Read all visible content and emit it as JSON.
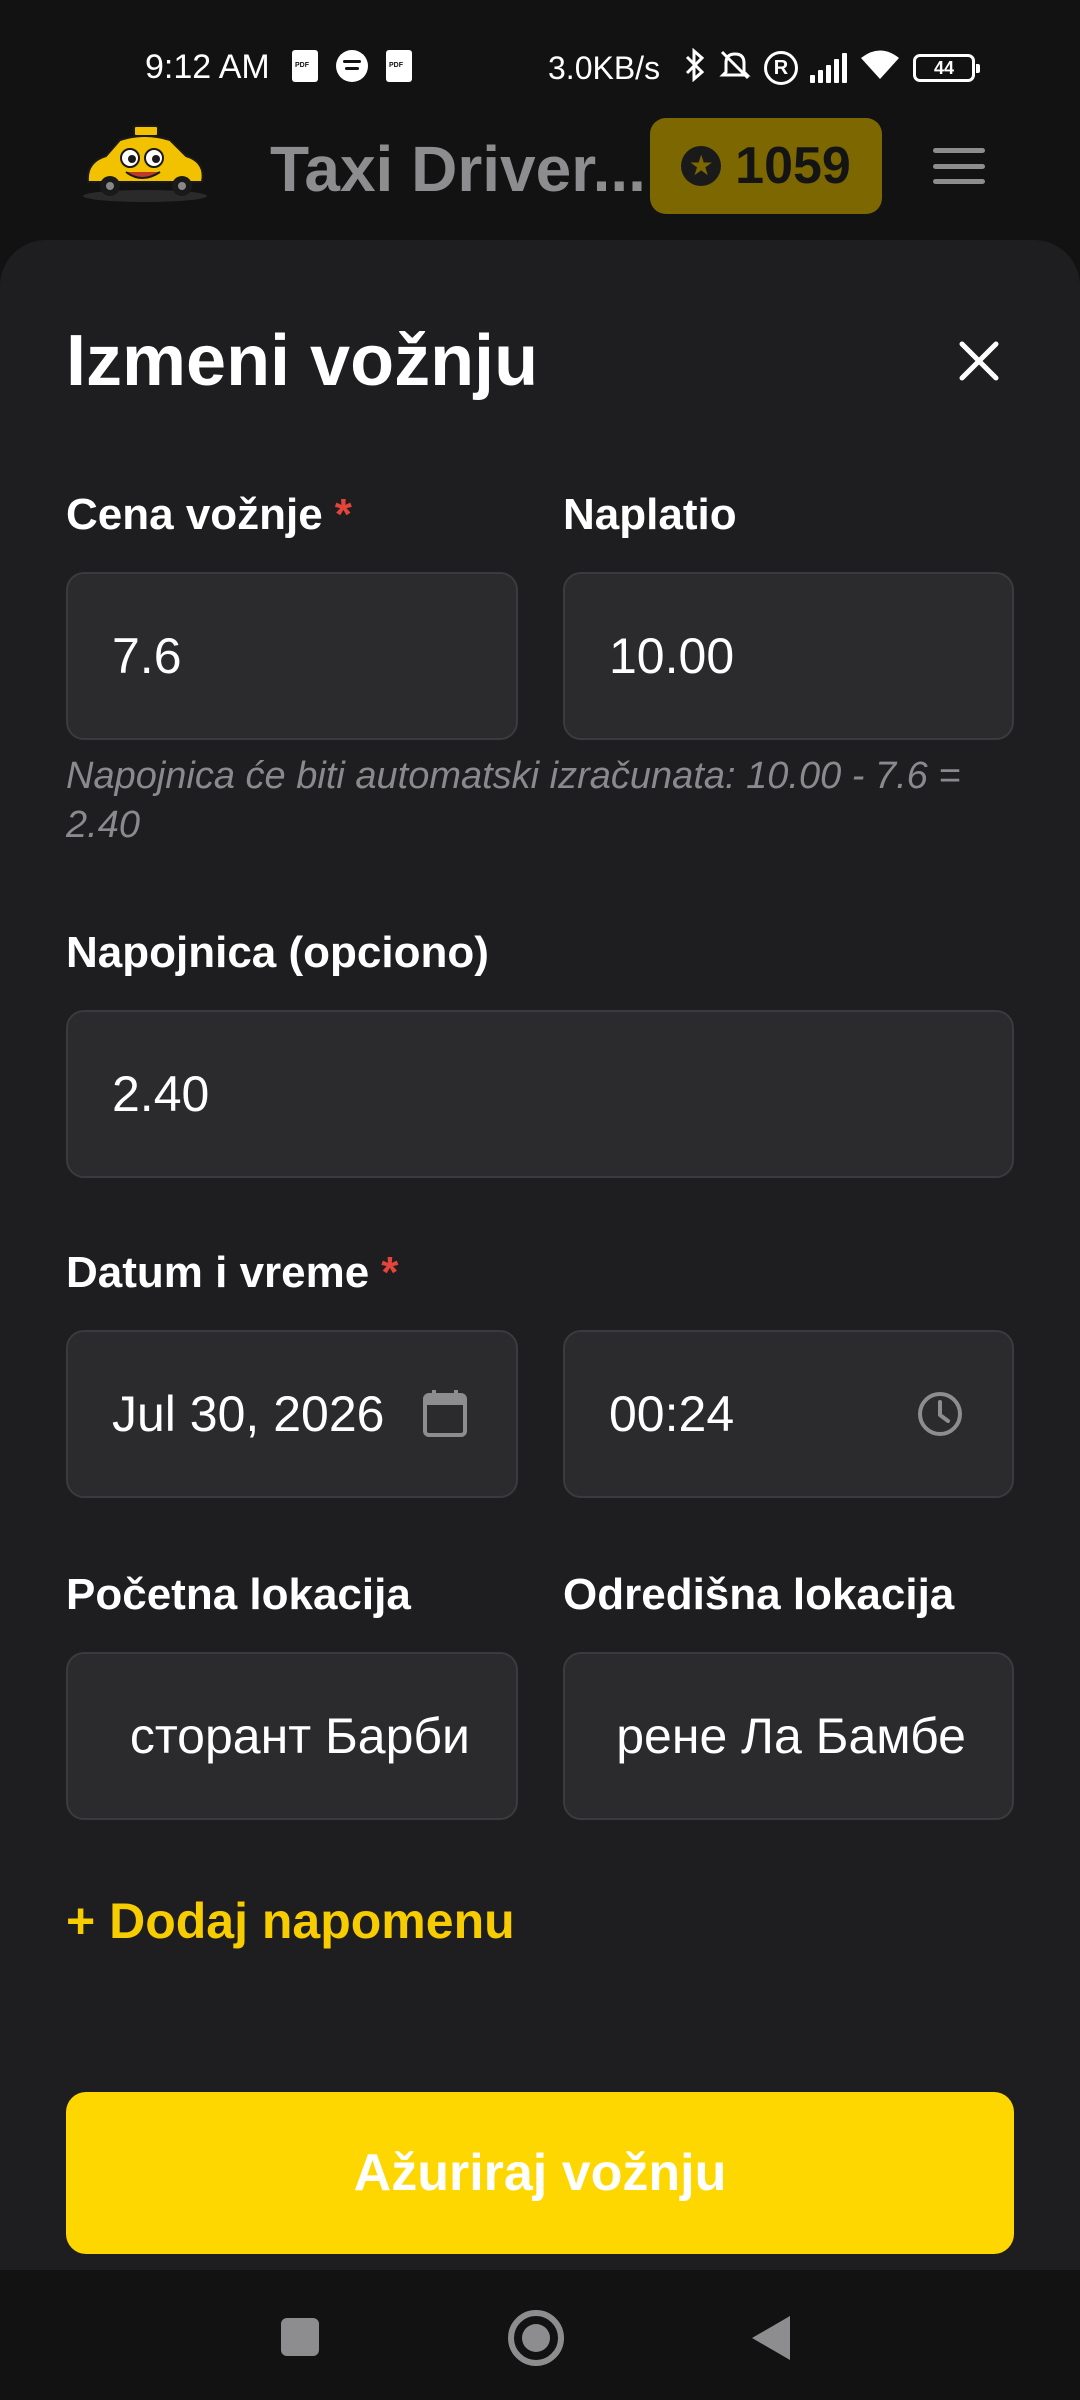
{
  "status_bar": {
    "time": "9:12 AM",
    "speed": "3.0KB/s",
    "battery": "44"
  },
  "header": {
    "title": "Taxi Driver...",
    "points": "1059",
    "accent": "#7c6700"
  },
  "sheet": {
    "title": "Izmeni vožnju",
    "price": {
      "label": "Cena vožnje",
      "required": "*",
      "value": "7.6"
    },
    "charged": {
      "label": "Naplatio",
      "value": "10.00"
    },
    "tip_hint": "Napojnica će biti automatski izračunata: 10.00 - 7.6 = 2.40",
    "tip": {
      "label": "Napojnica (opciono)",
      "value": "2.40"
    },
    "datetime": {
      "label": "Datum i vreme",
      "required": "*",
      "date": "Jul 30, 2026",
      "time": "00:24"
    },
    "start_location": {
      "label": "Početna lokacija",
      "value": "сторант Барби"
    },
    "end_location": {
      "label": "Odredišna lokacija",
      "value": "рене Ла Бамбе"
    },
    "add_note": "+ Dodaj napomenu",
    "submit": "Ažuriraj vožnju",
    "submit_color": "#fed700"
  }
}
